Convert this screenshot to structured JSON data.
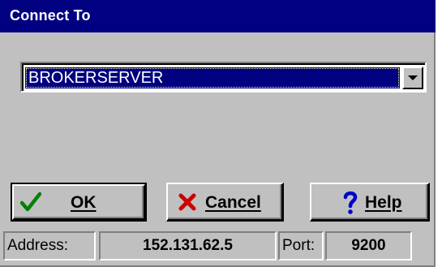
{
  "window": {
    "title": "Connect To"
  },
  "server_combo": {
    "selected": "BROKERSERVER"
  },
  "buttons": {
    "ok": "OK",
    "cancel": "Cancel",
    "help": "Help"
  },
  "status": {
    "address_label": "Address:",
    "address_value": "152.131.62.5",
    "port_label": "Port:",
    "port_value": "9200"
  },
  "colors": {
    "title_bar": "#000080",
    "selection": "#000080",
    "face": "#c0c0c0",
    "ok_check": "#008000",
    "cancel_x": "#cc0000",
    "help_mark": "#0000cc"
  }
}
